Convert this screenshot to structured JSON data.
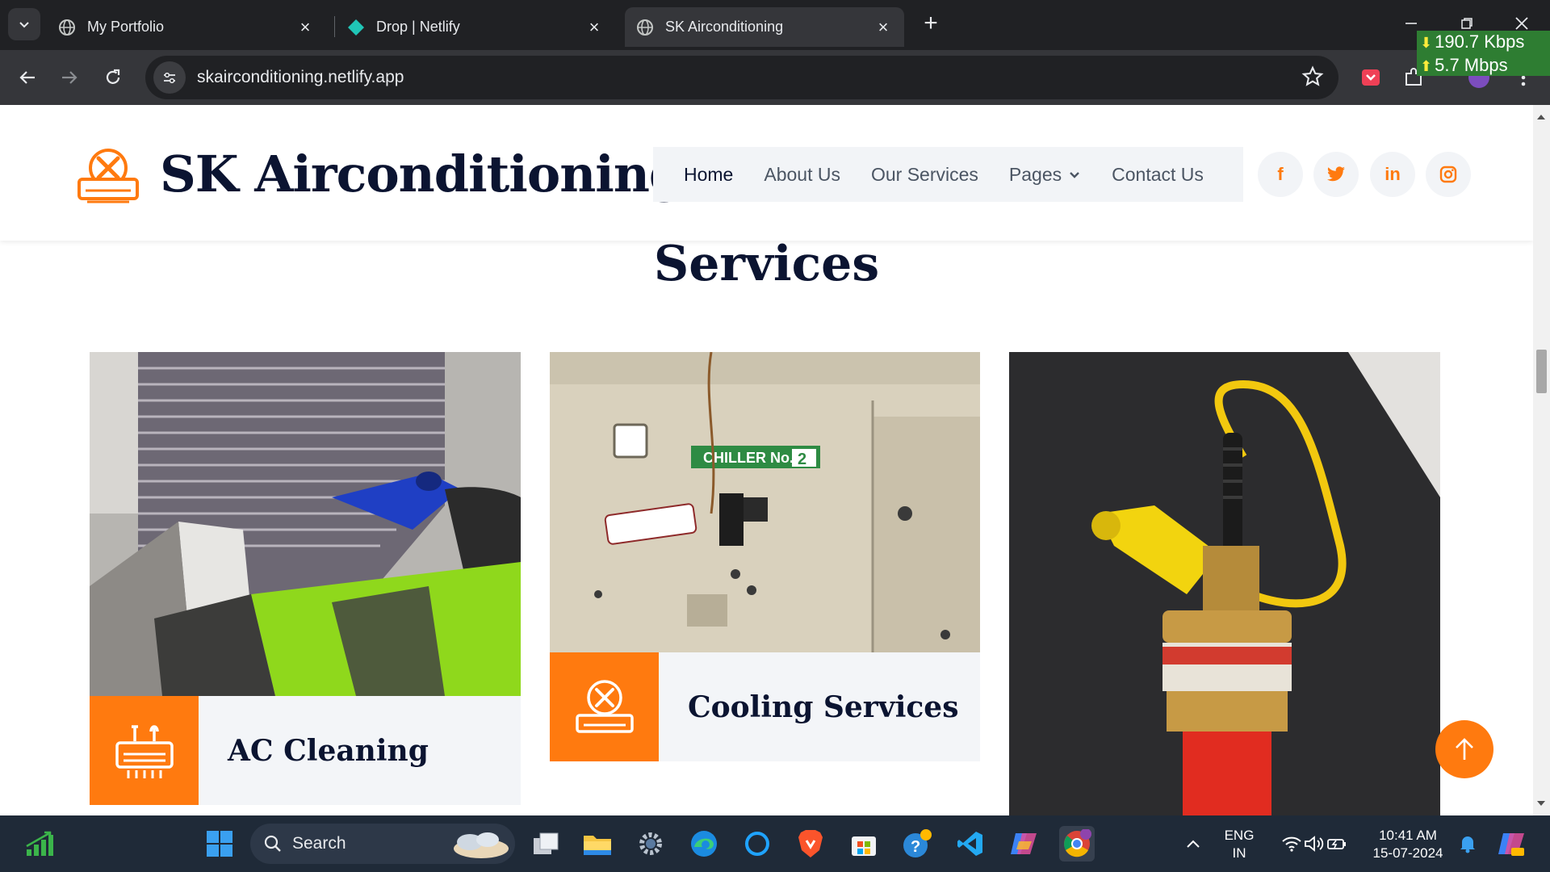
{
  "browser": {
    "tabs": [
      {
        "title": "My Portfolio",
        "favicon": "globe-icon",
        "active": false
      },
      {
        "title": "Drop | Netlify",
        "favicon": "netlify-icon",
        "active": false
      },
      {
        "title": "SK Airconditioning",
        "favicon": "globe-icon",
        "active": true
      }
    ],
    "url": "skairconditioning.netlify.app",
    "net_speed": {
      "down": "190.7 Kbps",
      "up": "5.7 Mbps"
    }
  },
  "site": {
    "brand": "SK Airconditioning",
    "nav": [
      "Home",
      "About Us",
      "Our Services",
      "Pages",
      "Contact Us"
    ],
    "social": {
      "facebook": "f",
      "linkedin": "in"
    },
    "section_title": "Services",
    "services": [
      {
        "caption": "AC Cleaning",
        "icon": "ac-unit-icon"
      },
      {
        "caption": "Cooling Services",
        "icon": "ac-repair-icon"
      },
      {
        "caption": "",
        "icon": ""
      }
    ],
    "photo_labels": {
      "chiller": "CHILLER No.",
      "chiller_num": "2"
    },
    "accent": "#ff7a0f",
    "heading_color": "#0b1431"
  },
  "taskbar": {
    "search_placeholder": "Search",
    "lang": "ENG",
    "region": "IN",
    "time": "10:41 AM",
    "date": "15-07-2024"
  }
}
